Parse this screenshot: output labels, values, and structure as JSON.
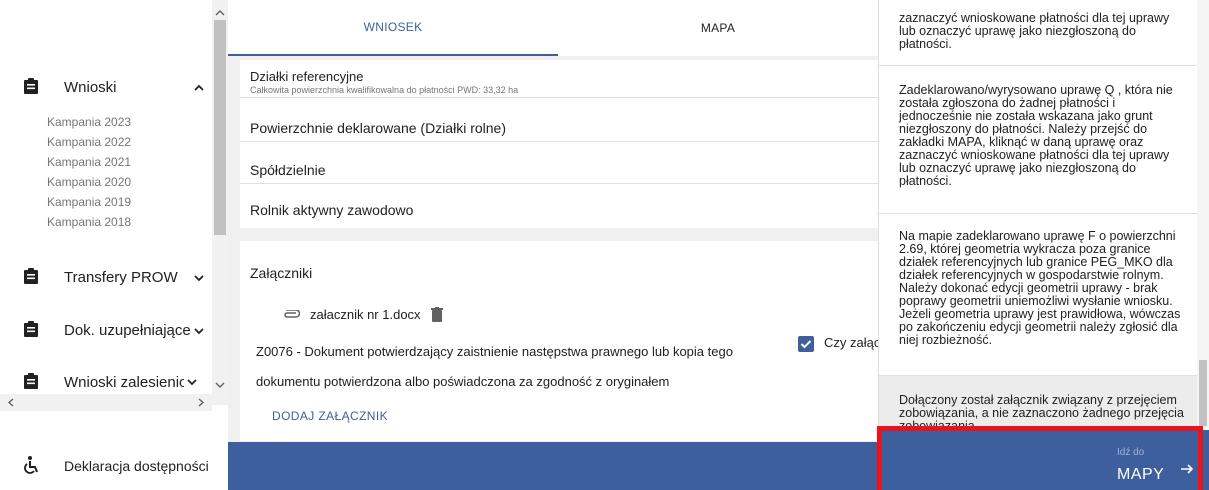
{
  "sidebar": {
    "wnioski": {
      "label": "Wnioski"
    },
    "campaigns": [
      "Kampania 2023",
      "Kampania 2022",
      "Kampania 2021",
      "Kampania 2020",
      "Kampania 2019",
      "Kampania 2018"
    ],
    "transfery": {
      "label": "Transfery PROW"
    },
    "dok": {
      "label": "Dok. uzupełniające"
    },
    "zalesieniowe": {
      "label": "Wnioski zalesieniowe"
    },
    "deklaracja": {
      "label": "Deklaracja dostępności"
    }
  },
  "tabs": {
    "wniosek": "WNIOSEK",
    "mapa": "MAPA"
  },
  "sections": {
    "dzialki": {
      "title": "Działki referencyjne",
      "subtitle": "Całkowita powierzchnia kwalifikowalna do płatności PWD: 33,32 ha"
    },
    "powierzchnie": "Powierzchnie deklarowane (Działki rolne)",
    "spoldzielnie": "Spółdzielnie",
    "rolnik": "Rolnik aktywny zawodowo"
  },
  "attachments": {
    "title": "Załączniki",
    "file": "załacznik nr 1.docx",
    "desc": "Z0076 - Dokument potwierdzający zaistnienie następstwa prawnego lub kopia tego dokumentu potwierdzona albo poświadczona za zgodność z oryginałem",
    "check_label": "Czy załącznik",
    "add": "DODAJ ZAŁĄCZNIK"
  },
  "panel": {
    "msg0": "zaznaczyć wnioskowane płatności dla tej uprawy lub oznaczyć uprawę jako niezgłoszoną do płatności.",
    "msg1": "Zadeklarowano/wyrysowano uprawę Q , która nie została zgłoszona do żadnej płatności i jednocześnie nie została wskazana jako grunt niezgłoszony do płatności. Należy przejść do zakładki MAPA, kliknąć w daną uprawę oraz zaznaczyć wnioskowane płatności dla tej uprawy lub oznaczyć uprawę jako niezgłoszoną do płatności.",
    "msg2": "Na mapie zadeklarowano uprawę F o powierzchni 2.69, której geometria wykracza poza granice działek referencyjnych lub granice PEG_MKO dla działek referencyjnych w gospodarstwie rolnym. Należy dokonać edycji geometrii uprawy - brak poprawy geometrii uniemożliwi wysłanie wniosku. Jeżeli geometria uprawy jest prawidłowa, wówczas po zakończeniu edycji geometrii należy zgłosić dla niej rozbieżność.",
    "msg3": "Dołączony został załącznik związany z przejęciem zobowiązania, a nie zaznaczono żadnego przejęcia zobowiązania."
  },
  "map_button": {
    "small": "Idź do",
    "label": "MAPY"
  },
  "colors": {
    "accent": "#3d5f9e",
    "highlight": "#e8141c"
  }
}
